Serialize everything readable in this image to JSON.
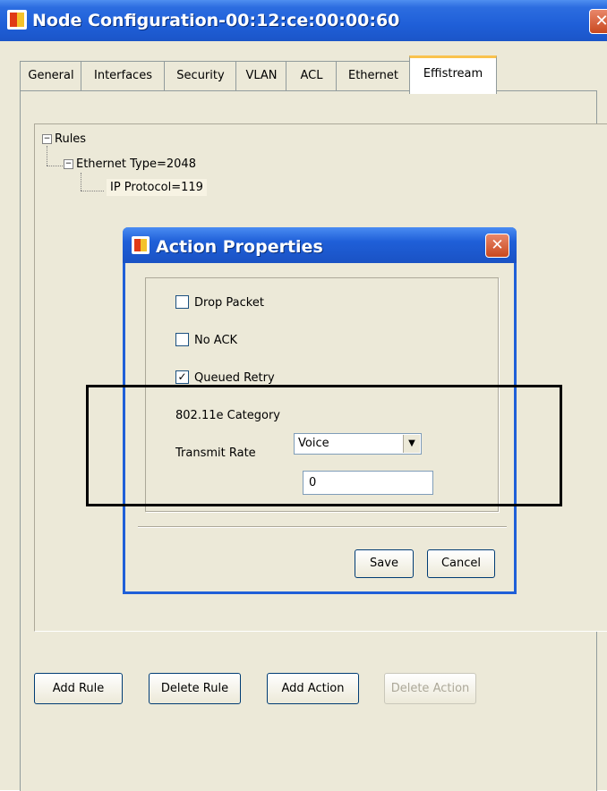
{
  "window": {
    "title": "Node Configuration-00:12:ce:00:00:60",
    "close_glyph": "✕"
  },
  "tabs": [
    {
      "label": "General"
    },
    {
      "label": "Interfaces"
    },
    {
      "label": "Security"
    },
    {
      "label": "VLAN"
    },
    {
      "label": "ACL"
    },
    {
      "label": "Ethernet"
    },
    {
      "label": "Effistream",
      "active": true
    }
  ],
  "tree": {
    "root": "Rules",
    "child": "Ethernet Type=2048",
    "grandchild": "IP Protocol=119",
    "expander_glyph": "−"
  },
  "dialog": {
    "title": "Action Properties",
    "close_glyph": "✕",
    "drop_packet": {
      "label": "Drop Packet",
      "checked": false
    },
    "no_ack": {
      "label": "No ACK",
      "checked": false
    },
    "queued_retry": {
      "label": "Queued Retry",
      "checked": true,
      "check_glyph": "✓"
    },
    "category_label": "802.11e Category",
    "category_value": "Voice",
    "combo_arrow": "▼",
    "transmit_label": "Transmit Rate",
    "transmit_value": "0",
    "save_label": "Save",
    "cancel_label": "Cancel"
  },
  "buttons": {
    "add_rule": "Add Rule",
    "delete_rule": "Delete Rule",
    "add_action": "Add Action",
    "delete_action": "Delete Action"
  },
  "colors": {
    "titlebar": "#1f5fd8",
    "highlight_box": "#000000",
    "active_tab_accent": "#f9c24d"
  }
}
